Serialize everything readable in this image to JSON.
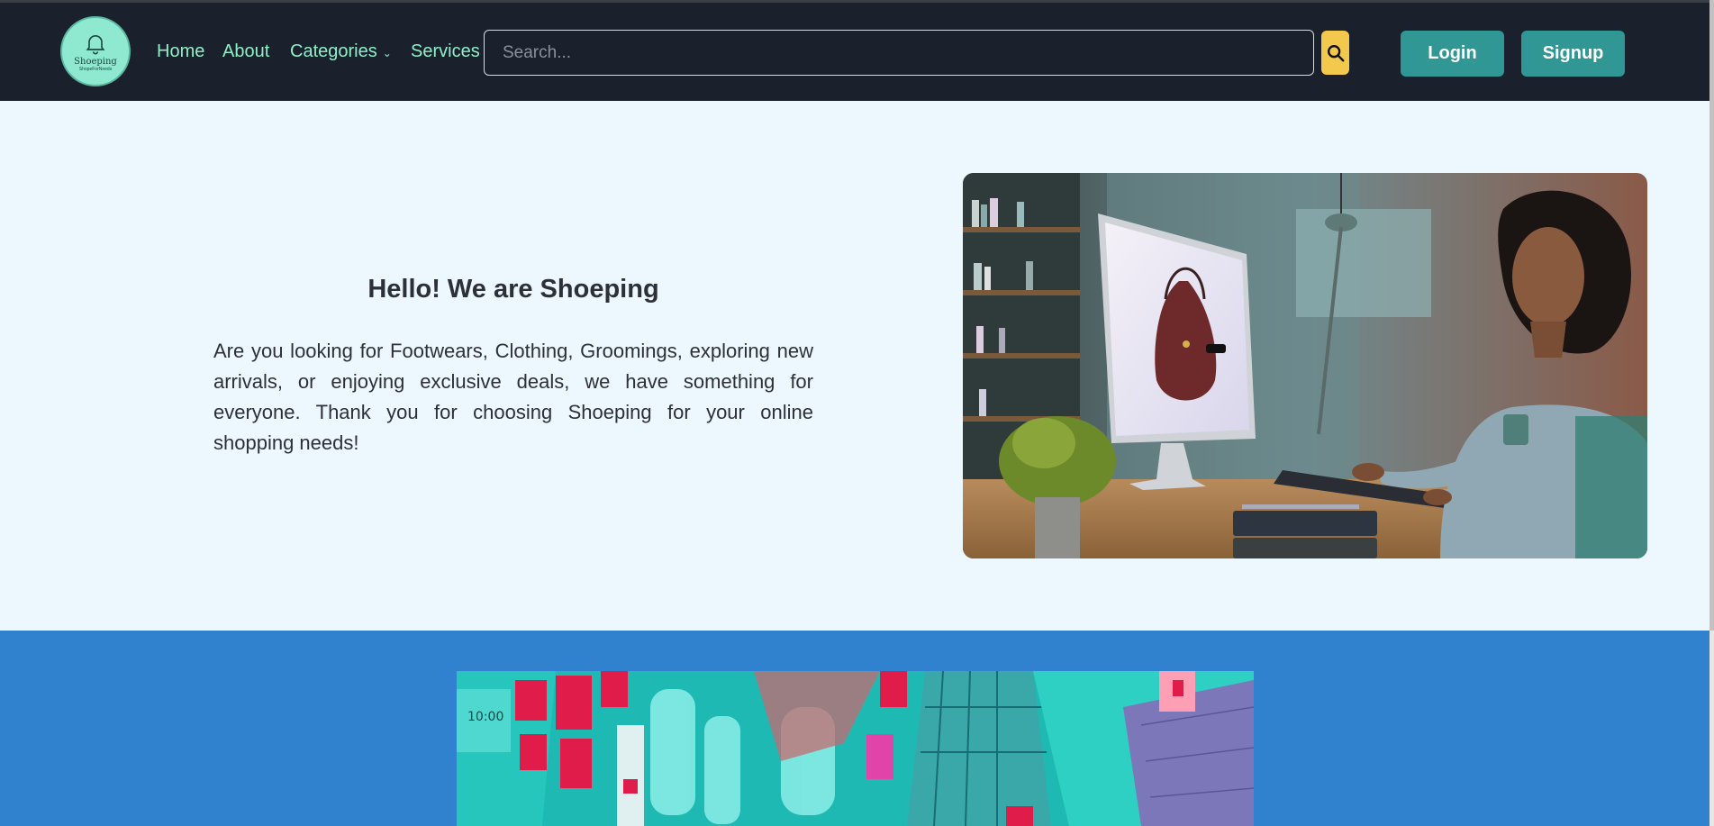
{
  "brand": {
    "name": "Shoeping",
    "tagline": "ShopeForNeeds"
  },
  "nav": {
    "home": "Home",
    "about": "About",
    "categories": "Categories",
    "services": "Services"
  },
  "search": {
    "placeholder": "Search...",
    "value": ""
  },
  "auth": {
    "login": "Login",
    "signup": "Signup"
  },
  "hero": {
    "title": "Hello! We are Shoeping",
    "text": "Are you looking for Footwears, Clothing, Groomings, exploring new arrivals, or enjoying exclusive deals, we have something for everyone. Thank you for choosing Shoeping for your online shopping needs!"
  },
  "colors": {
    "navbar": "#1a202c",
    "accent": "#319795",
    "nav_link": "#8ff0c8",
    "search_button": "#f2c94c",
    "hero_bg": "#ecf8fe",
    "banner_bg": "#3182ce"
  }
}
